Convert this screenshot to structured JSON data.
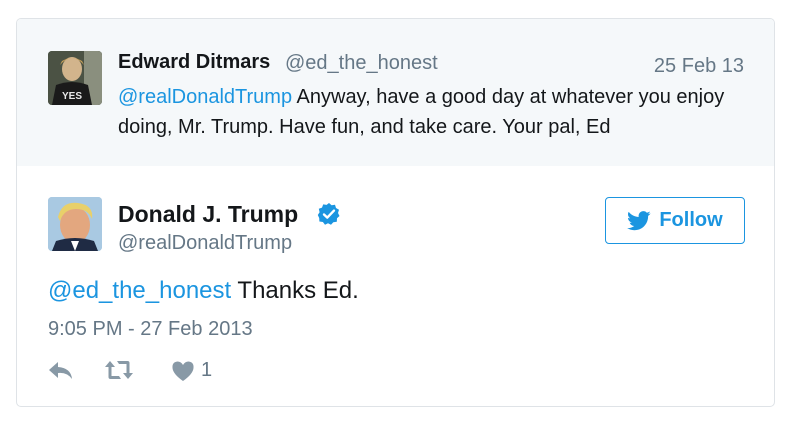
{
  "parent_tweet": {
    "author_name": "Edward Ditmars",
    "author_handle": "@ed_the_honest",
    "date": "25 Feb 13",
    "mention": "@realDonaldTrump",
    "text": " Anyway, have a good day at whatever you enjoy doing, Mr. Trump. Have fun, and take care. Your pal, Ed",
    "avatar_shirt_text": "YES"
  },
  "tweet": {
    "author_name": "Donald J. Trump",
    "author_handle": "@realDonaldTrump",
    "verified": true,
    "follow_label": "Follow",
    "mention": "@ed_the_honest",
    "text": " Thanks Ed.",
    "timestamp": "9:05 PM - 27 Feb 2013",
    "like_count": "1"
  },
  "colors": {
    "link": "#1b95e0",
    "muted": "#657786",
    "parent_background": "#f5f8fa",
    "icon_gray": "#8899a6"
  },
  "icons": {
    "reply": "reply-icon",
    "retweet": "retweet-icon",
    "like": "heart-icon",
    "verified": "verified-badge-icon",
    "follow": "twitter-bird-icon"
  }
}
